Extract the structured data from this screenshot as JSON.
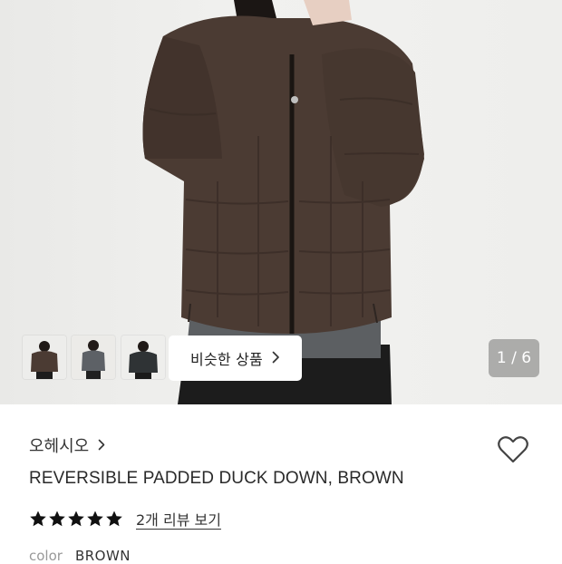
{
  "gallery": {
    "similar_label": "비슷한 상품",
    "counter": "1 / 6",
    "thumbnails": [
      "thumbnail-1",
      "thumbnail-2",
      "thumbnail-3"
    ]
  },
  "product": {
    "brand": "오헤시오",
    "title": "REVERSIBLE PADDED DUCK DOWN, BROWN",
    "rating": 5,
    "review_link": "2개 리뷰 보기",
    "color_key": "color",
    "color_value": "BROWN"
  },
  "colors": {
    "jacket": "#4b3b33",
    "star": "#111111",
    "counter_bg": "#5a5a5a"
  },
  "icons": [
    "chevron-right-icon",
    "heart-icon",
    "star-icon"
  ]
}
